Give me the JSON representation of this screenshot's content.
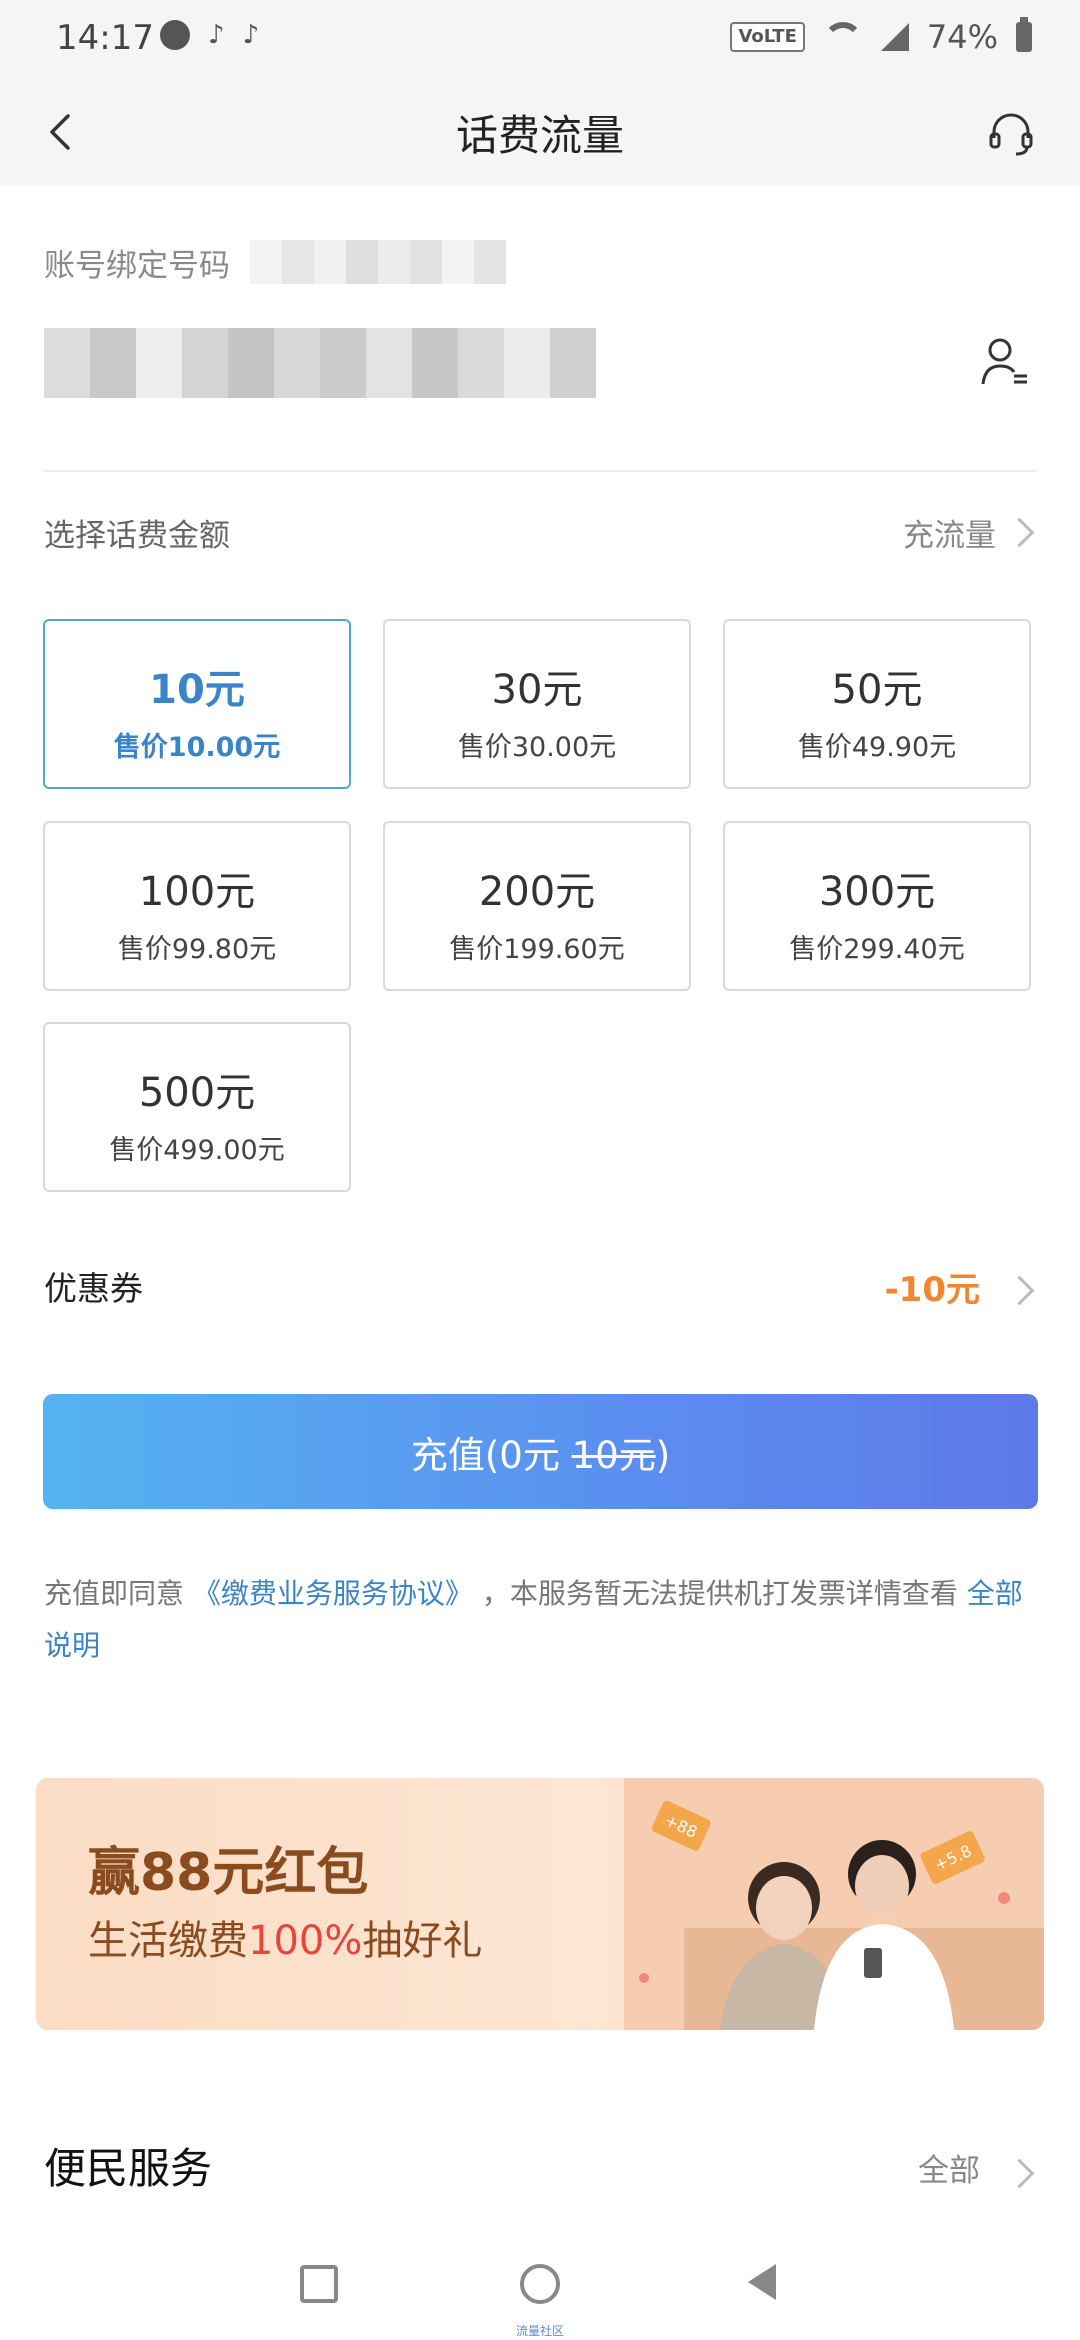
{
  "status_bar": {
    "time": "14:17",
    "volte": "VoLTE",
    "battery": "74%"
  },
  "nav": {
    "title": "话费流量"
  },
  "account": {
    "label": "账号绑定号码"
  },
  "section": {
    "label": "选择话费金额",
    "link": "充流量"
  },
  "amounts": [
    {
      "value": "10元",
      "price": "售价10.00元",
      "selected": true
    },
    {
      "value": "30元",
      "price": "售价30.00元"
    },
    {
      "value": "50元",
      "price": "售价49.90元"
    },
    {
      "value": "100元",
      "price": "售价99.80元"
    },
    {
      "value": "200元",
      "price": "售价199.60元"
    },
    {
      "value": "300元",
      "price": "售价299.40元"
    },
    {
      "value": "500元",
      "price": "售价499.00元"
    }
  ],
  "coupon": {
    "label": "优惠券",
    "value": "-10元"
  },
  "recharge": {
    "label_prefix": "充值(0元 ",
    "original": "10元",
    "label_suffix": ")"
  },
  "agreement": {
    "prefix": "充值即同意 ",
    "link": "《缴费业务服务协议》",
    "middle": " ，本服务暂无法提供机打发票详情查看 ",
    "more": "全部说明"
  },
  "banner": {
    "title": "赢88元红包",
    "sub_prefix": "生活缴费",
    "sub_highlight": "100%",
    "sub_suffix": "抽好礼",
    "tag1": "+88",
    "tag2": "+5.8"
  },
  "services": {
    "title": "便民服务",
    "all": "全部"
  },
  "system_nav": {
    "caption": "流量社区"
  },
  "colors": {
    "accent": "#3a84c8",
    "coupon": "#f0862d",
    "button_start": "#55b3f0",
    "button_end": "#5e79e8"
  }
}
